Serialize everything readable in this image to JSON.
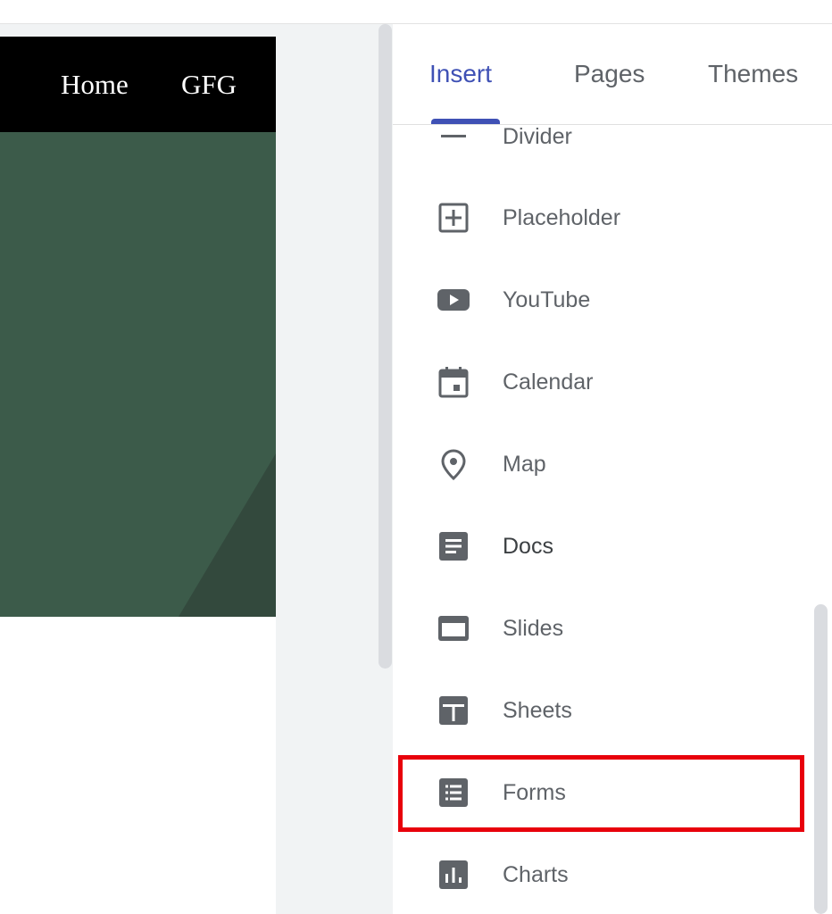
{
  "site_nav": {
    "links": [
      "Home",
      "GFG"
    ]
  },
  "panel": {
    "tabs": [
      {
        "label": "Insert",
        "active": true
      },
      {
        "label": "Pages",
        "active": false
      },
      {
        "label": "Themes",
        "active": false
      }
    ],
    "items": [
      {
        "label": "Divider",
        "icon": "divider-icon"
      },
      {
        "label": "Placeholder",
        "icon": "placeholder-icon"
      },
      {
        "label": "YouTube",
        "icon": "youtube-icon"
      },
      {
        "label": "Calendar",
        "icon": "calendar-icon"
      },
      {
        "label": "Map",
        "icon": "map-pin-icon"
      },
      {
        "label": "Docs",
        "icon": "docs-icon"
      },
      {
        "label": "Slides",
        "icon": "slides-icon"
      },
      {
        "label": "Sheets",
        "icon": "sheets-icon"
      },
      {
        "label": "Forms",
        "icon": "forms-icon",
        "highlighted": true
      },
      {
        "label": "Charts",
        "icon": "charts-icon"
      }
    ]
  },
  "colors": {
    "accent": "#3f51b5",
    "icon": "#5f6368",
    "highlight": "#e8000b",
    "hero": "#3c5b4a",
    "nav": "#000000"
  }
}
